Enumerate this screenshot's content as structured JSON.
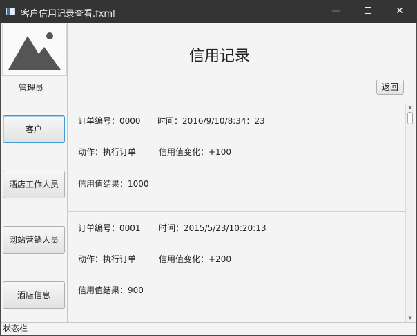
{
  "window": {
    "title": "客户信用记录查看.fxml",
    "icons": {
      "app": "app-window-icon",
      "minimize": "minimize-icon",
      "maximize": "maximize-icon",
      "close": "close-icon"
    },
    "close_glyph": "✕"
  },
  "sidebar": {
    "avatar_icon": "image-placeholder-icon",
    "user_label": "管理员",
    "buttons": [
      {
        "label": "客户",
        "active": true
      },
      {
        "label": "酒店工作人员",
        "active": false
      },
      {
        "label": "网站营销人员",
        "active": false
      },
      {
        "label": "酒店信息",
        "active": false
      }
    ]
  },
  "main": {
    "title": "信用记录",
    "back_label": "返回",
    "records": [
      {
        "order": "订单编号：0000",
        "time": "时间：2016/9/10/8:34：23",
        "action": "动作：执行订单",
        "change": "信用值变化：+100",
        "result": "信用值结果：1000"
      },
      {
        "order": "订单编号：0001",
        "time": "时间：2015/5/23/10:20:13",
        "action": "动作：执行订单",
        "change": "信用值变化：+200",
        "result": "信用值结果：900"
      }
    ]
  },
  "scrollbar": {
    "up_glyph": "▲",
    "down_glyph": "▼"
  },
  "status_bar": {
    "text": "状态栏"
  },
  "colors": {
    "titlebar_bg": "#343434",
    "window_bg": "#f4f4f4",
    "active_border": "#3f9ad8",
    "text": "#222222"
  }
}
